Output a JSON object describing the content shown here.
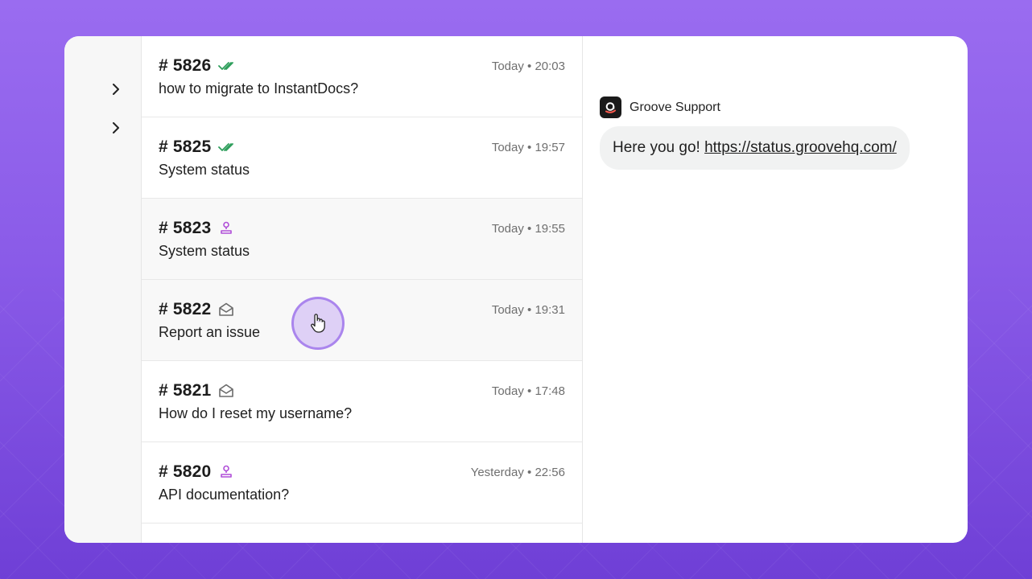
{
  "colors": {
    "accent": "#8a5be8",
    "check_green": "#2e9e5b",
    "assign_purple": "#b04fd8",
    "gray_icon": "#6a6a6a"
  },
  "rail": {
    "items": [
      {
        "icon": "chevron-right-icon"
      },
      {
        "icon": "chevron-right-icon"
      }
    ]
  },
  "tickets": [
    {
      "number": "# 5826",
      "status_icon": "double-check-icon",
      "time": "Today • 20:03",
      "subject": "how to migrate to InstantDocs?"
    },
    {
      "number": "# 5825",
      "status_icon": "double-check-icon",
      "time": "Today • 19:57",
      "subject": "System status"
    },
    {
      "number": "# 5823",
      "status_icon": "assigned-stamp-icon",
      "time": "Today • 19:55",
      "subject": "System status"
    },
    {
      "number": "# 5822",
      "status_icon": "open-envelope-icon",
      "time": "Today • 19:31",
      "subject": "Report an issue"
    },
    {
      "number": "# 5821",
      "status_icon": "open-envelope-icon",
      "time": "Today • 17:48",
      "subject": "How do I reset my username?"
    },
    {
      "number": "# 5820",
      "status_icon": "assigned-stamp-icon",
      "time": "Yesterday • 22:56",
      "subject": "API documentation?"
    }
  ],
  "conversation": {
    "sender": "Groove Support",
    "message_text": "Here you go! ",
    "message_link": "https://status.groovehq.com/"
  }
}
